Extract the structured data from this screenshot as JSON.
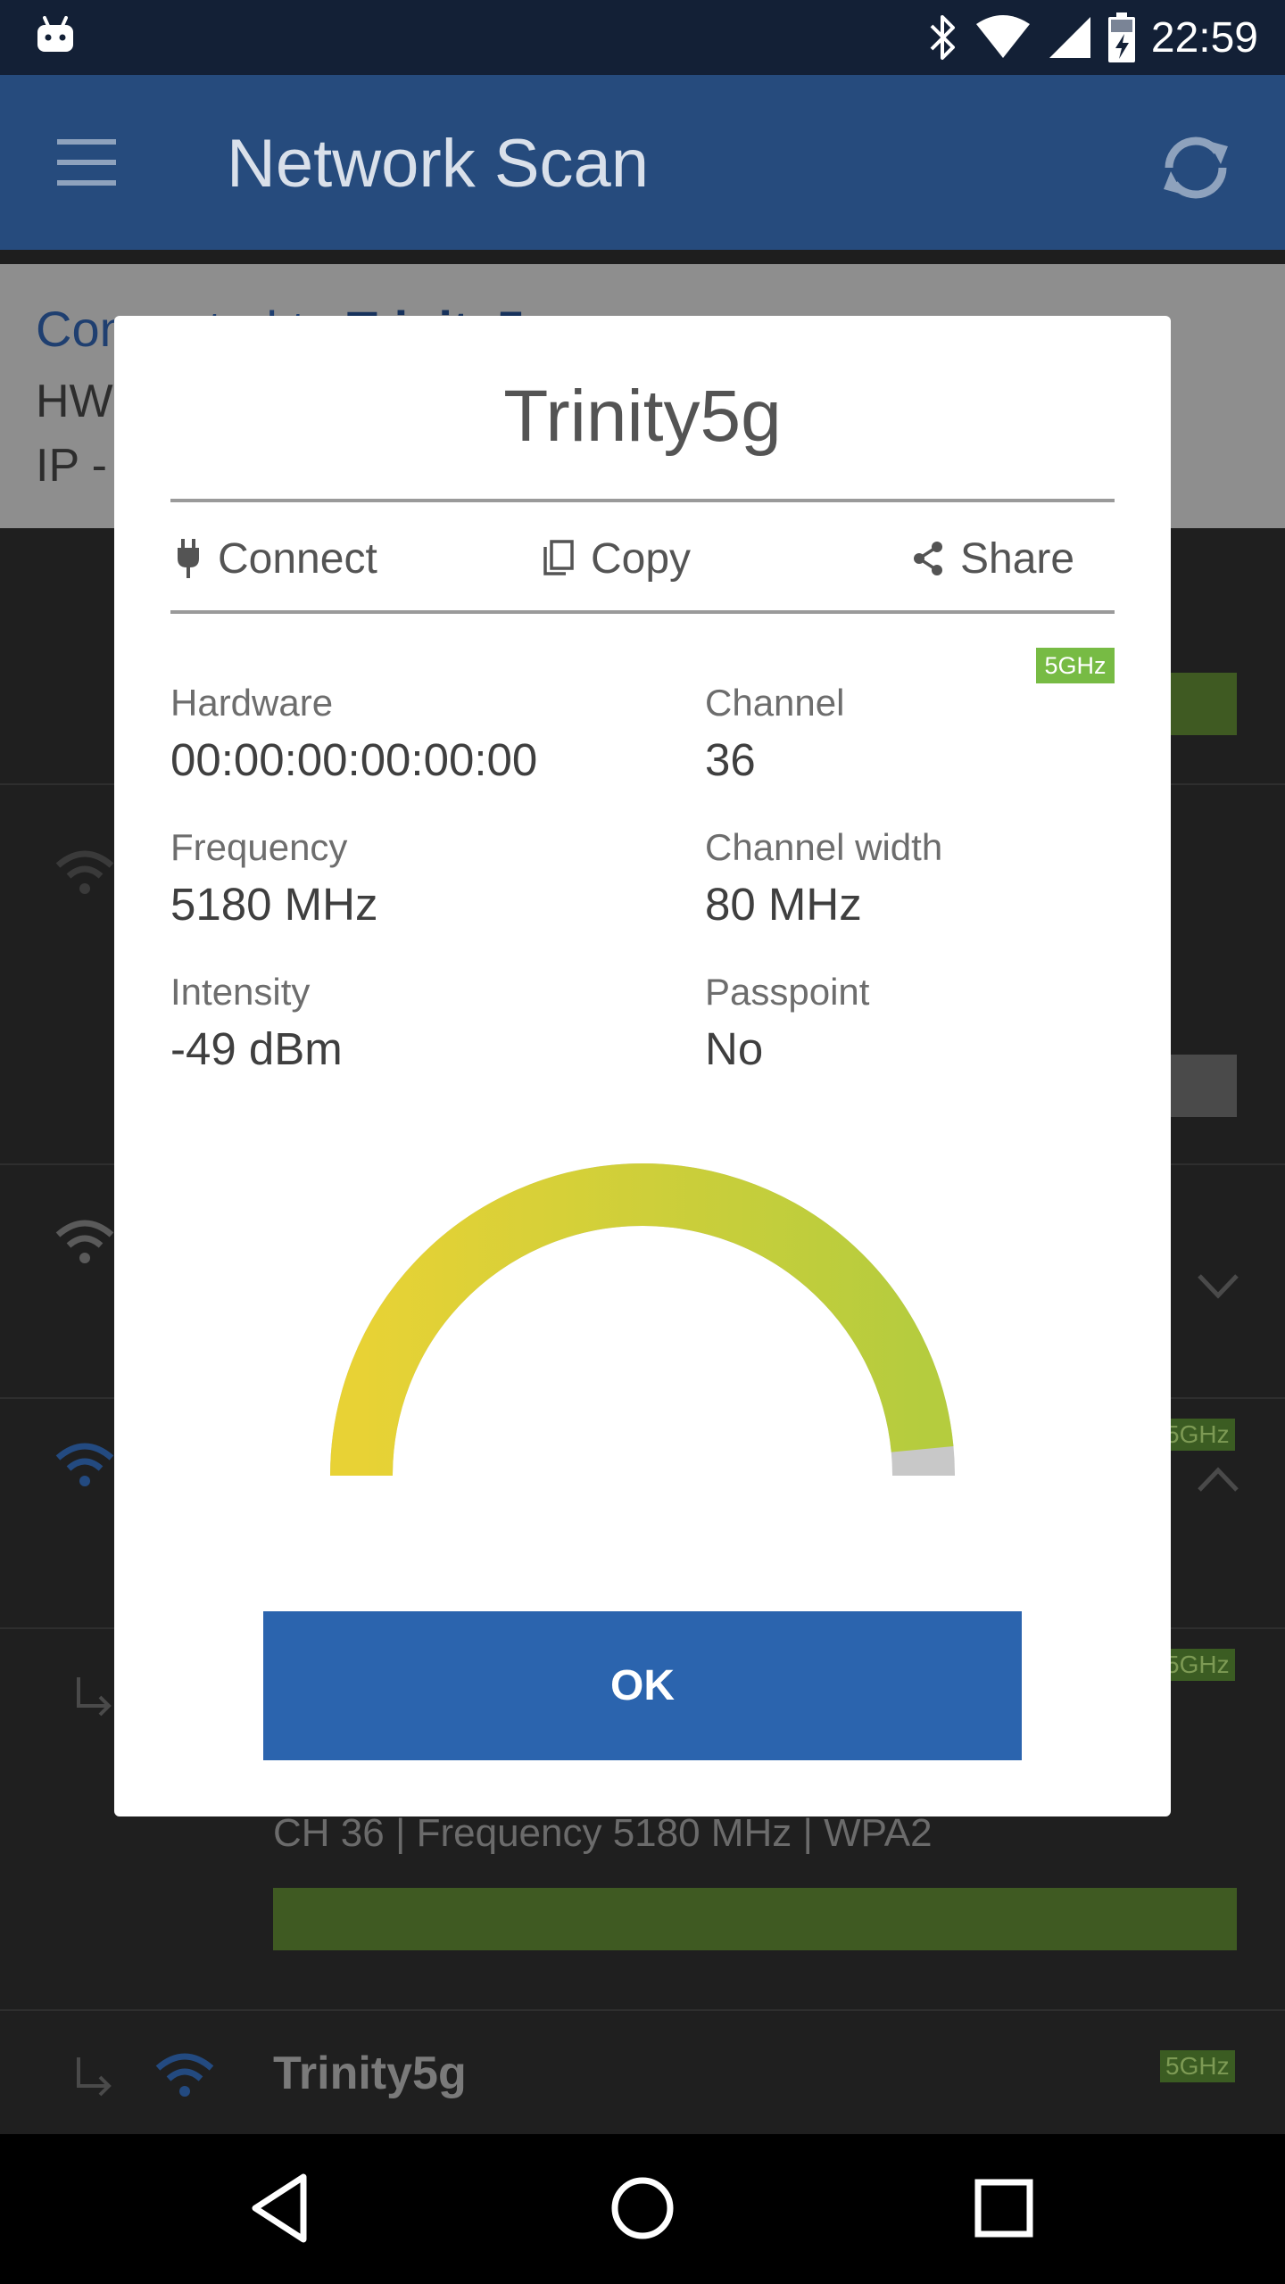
{
  "status_bar": {
    "time": "22:59",
    "icons": [
      "android-icon",
      "bluetooth-icon",
      "wifi-signal-icon",
      "cell-signal-icon",
      "battery-charging-icon"
    ]
  },
  "app_bar": {
    "title": "Network Scan",
    "menu_icon": "menu-icon",
    "refresh_icon": "refresh-icon"
  },
  "background": {
    "connected_prefix": "Con",
    "connected_name": "Trinity5",
    "hw_prefix": "HW",
    "ip_prefix": "IP -",
    "list_badge": "5GHz",
    "row_detail": "CH 36 | Frequency 5180 MHz | WPA2",
    "last_row_title": "Trinity5g"
  },
  "dialog": {
    "title": "Trinity5g",
    "actions": {
      "connect": "Connect",
      "copy": "Copy",
      "share": "Share"
    },
    "band_badge": "5GHz",
    "fields": {
      "hardware": {
        "label": "Hardware",
        "value": "00:00:00:00:00:00"
      },
      "channel": {
        "label": "Channel",
        "value": "36"
      },
      "frequency": {
        "label": "Frequency",
        "value": "5180 MHz"
      },
      "channel_width": {
        "label": "Channel width",
        "value": "80 MHz"
      },
      "intensity": {
        "label": "Intensity",
        "value": "-49 dBm"
      },
      "passpoint": {
        "label": "Passpoint",
        "value": "No"
      }
    },
    "signal_gauge_fraction": 0.97,
    "ok_label": "OK"
  },
  "colors": {
    "app_bar": "#264b7d",
    "status_bar": "#132036",
    "ok_button": "#2b64ae",
    "band_badge": "#77bb44",
    "gauge_start": "#e8d235",
    "gauge_end": "#b5cc3e"
  }
}
